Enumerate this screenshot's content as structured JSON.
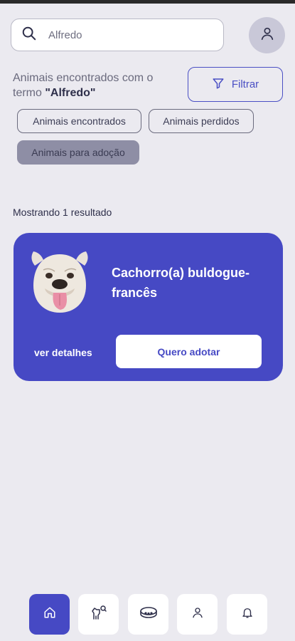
{
  "search": {
    "value": "Alfredo",
    "icon": "search-icon"
  },
  "header": {
    "results_text": "Animais encontrados com o termo ",
    "term": "\"Alfredo\"",
    "filter_label": "Filtrar"
  },
  "chips": [
    {
      "label": "Animais encontrados",
      "active": false
    },
    {
      "label": "Animais perdidos",
      "active": false
    },
    {
      "label": "Animais para adoção",
      "active": true
    }
  ],
  "results": {
    "count_text": "Mostrando 1 resultado",
    "items": [
      {
        "name": "Cachorro(a) buldogue-francês",
        "details_label": "ver detalhes",
        "adopt_label": "Quero adotar"
      }
    ]
  },
  "bottom_nav": [
    {
      "icon": "home-icon",
      "active": true
    },
    {
      "icon": "pet-search-icon",
      "active": false
    },
    {
      "icon": "collar-icon",
      "active": false
    },
    {
      "icon": "profile-icon",
      "active": false
    },
    {
      "icon": "bell-icon",
      "active": false
    }
  ],
  "colors": {
    "primary": "#4649c4",
    "background": "#ebeaf0",
    "chip_active": "#8e8ea5"
  }
}
